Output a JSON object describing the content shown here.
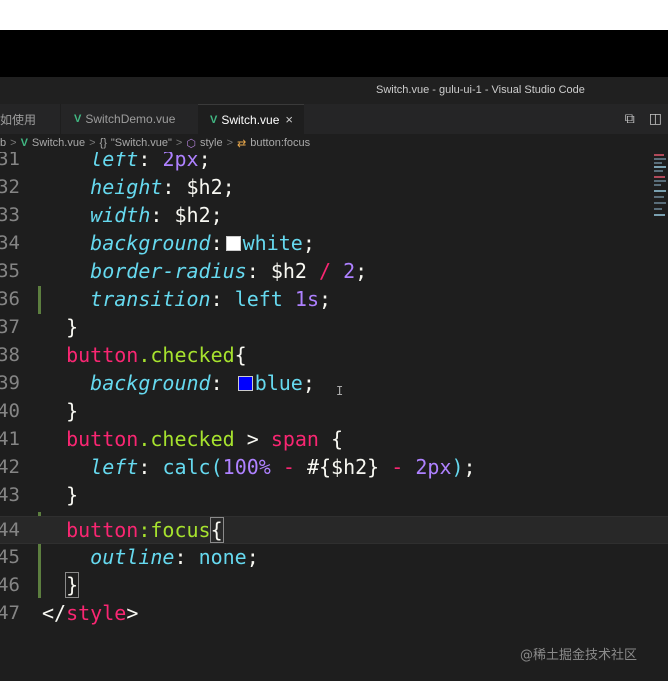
{
  "window": {
    "title": "Switch.vue - gulu-ui-1 - Visual Studio Code"
  },
  "tabs": [
    {
      "label": "如使用",
      "active": false
    },
    {
      "label": "SwitchDemo.vue",
      "active": false
    },
    {
      "label": "Switch.vue",
      "active": true,
      "close": "×"
    }
  ],
  "tab_actions": {
    "split": "◫",
    "layout": "⧉"
  },
  "breadcrumb": {
    "root": "b",
    "file": "Switch.vue",
    "component": "\"Switch.vue\"",
    "style": "style",
    "selector": "button:focus",
    "sep": ">",
    "braces": "{}"
  },
  "code": {
    "lines": [
      {
        "n": "31"
      },
      {
        "n": "32"
      },
      {
        "n": "33"
      },
      {
        "n": "34"
      },
      {
        "n": "35"
      },
      {
        "n": "36"
      },
      {
        "n": "37"
      },
      {
        "n": "38"
      },
      {
        "n": "39"
      },
      {
        "n": "40"
      },
      {
        "n": "41"
      },
      {
        "n": "42"
      },
      {
        "n": "43"
      },
      {
        "n": "44"
      },
      {
        "n": "45"
      },
      {
        "n": "46"
      },
      {
        "n": "47"
      }
    ],
    "t": {
      "left": "left",
      "two_px": "2px",
      "height": "height",
      "width": "width",
      "h2": "$h2",
      "background": "background",
      "white": "white",
      "border_radius": "border-radius",
      "slash": "/",
      "two": "2",
      "transition": "transition",
      "one_s": "1s",
      "button": "button",
      "checked": ".checked",
      "blue": "blue",
      "gt": ">",
      "span": "span",
      "calc": "calc(",
      "hundred": "100%",
      "minus": "-",
      "interp": "#{$h2}",
      "close_paren": ")",
      "focus": ":focus",
      "outline": "outline",
      "none": "none",
      "style_tag": "style",
      "open_tag": "</",
      "close_tag": ">"
    },
    "colors": {
      "white_swatch": "#ffffff",
      "blue_swatch": "#0000ff"
    }
  },
  "watermark": "@稀土掘金技术社区"
}
